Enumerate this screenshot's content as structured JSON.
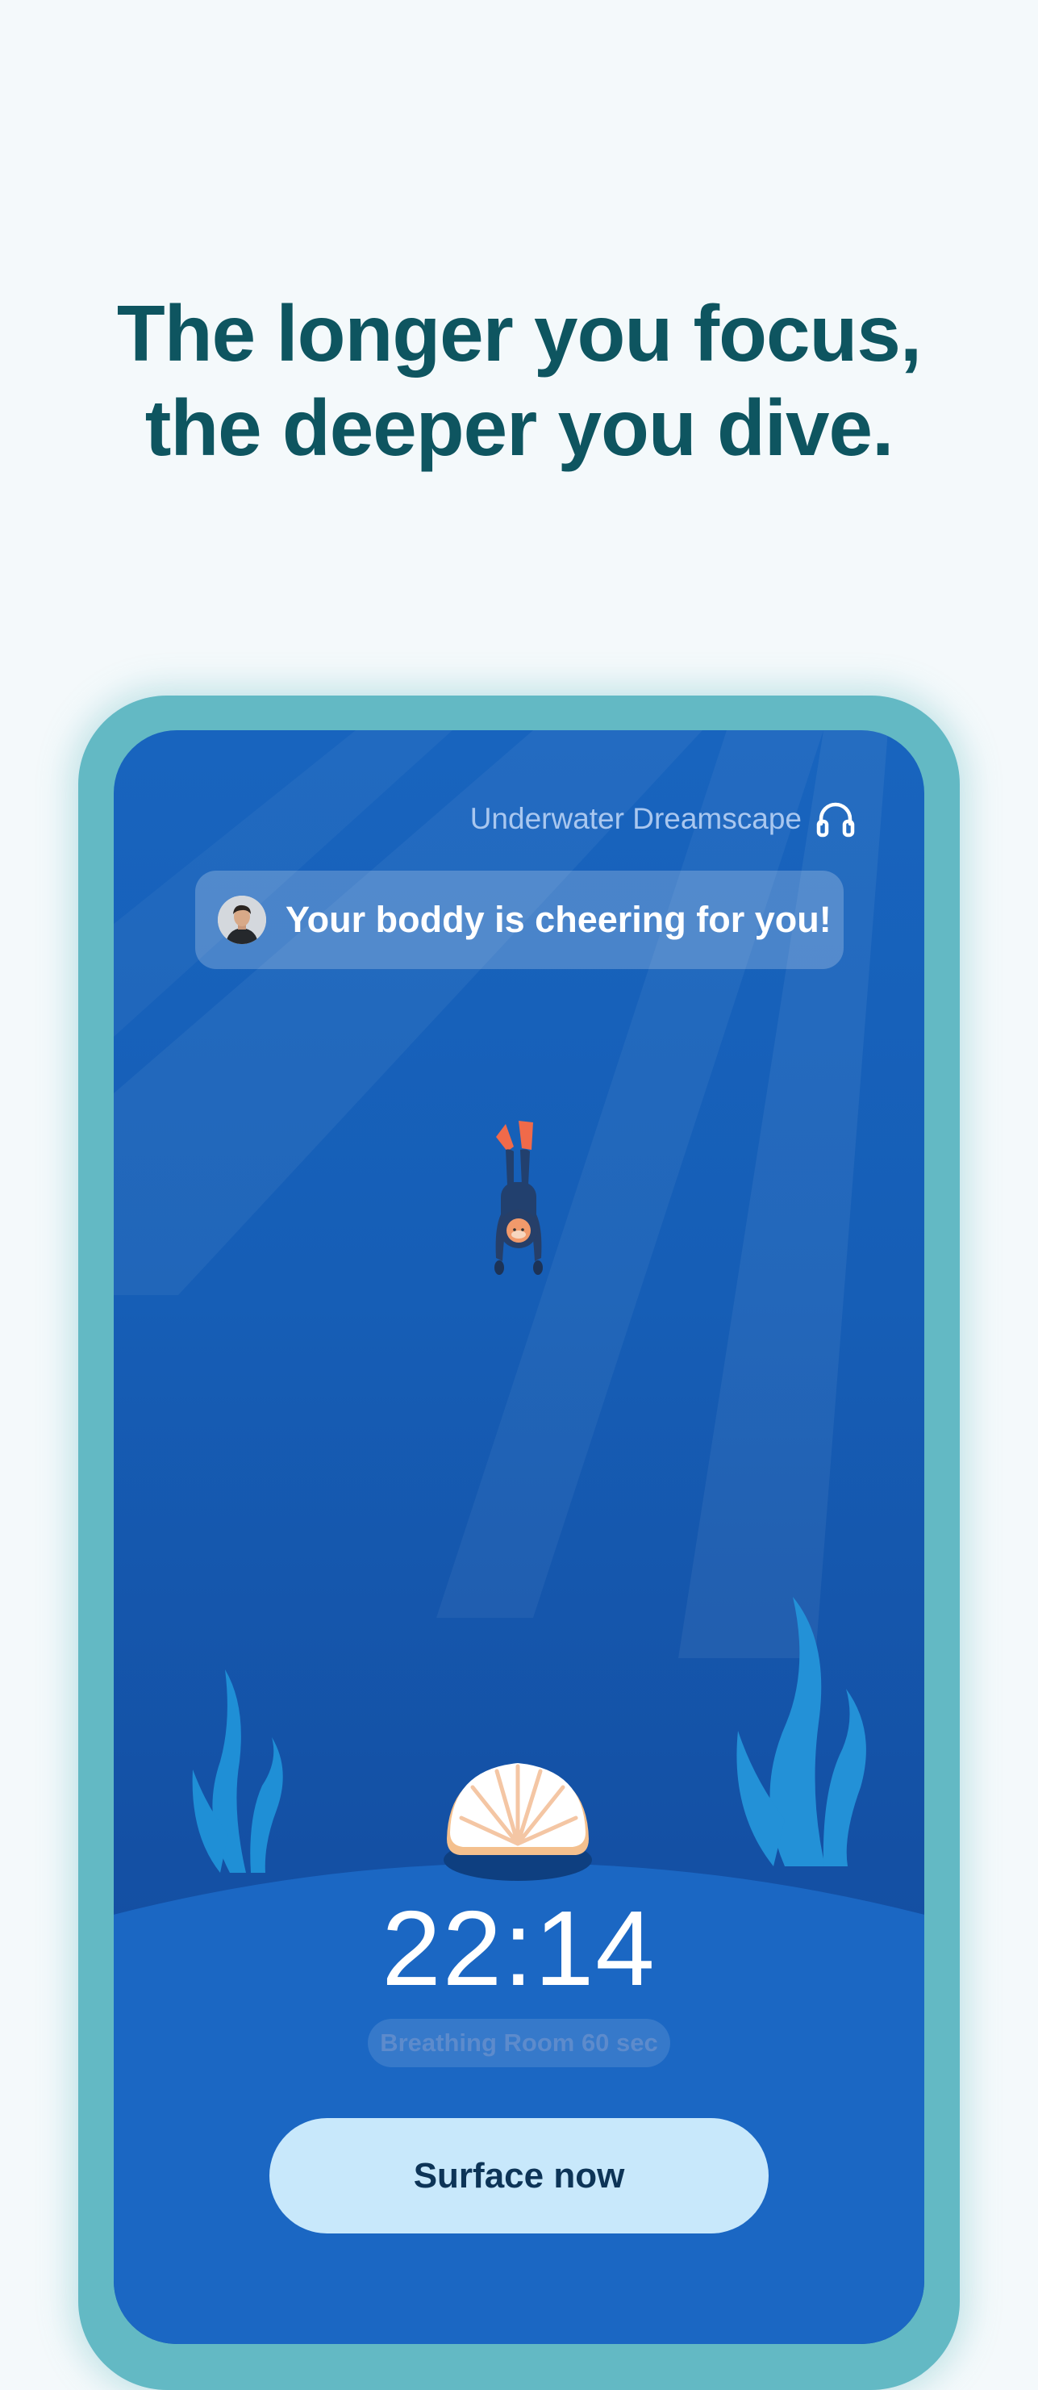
{
  "headline": {
    "line1": "The longer you focus,",
    "line2": "the deeper you dive."
  },
  "ambient": {
    "track": "Underwater Dreamscape",
    "icon": "headphones-icon"
  },
  "toast": {
    "message": "Your boddy is cheering for you!",
    "avatar": "avatar"
  },
  "timer": {
    "value": "22:14"
  },
  "breathing": {
    "label": "Breathing Room 60 sec"
  },
  "actions": {
    "surface_label": "Surface now"
  },
  "colors": {
    "headline": "#0e5560",
    "frame": "#63b9c4",
    "ocean": "#1660b8",
    "button": "#c8e8fb",
    "fins": "#f06a4a",
    "seaweed": "#1f8fd6"
  }
}
